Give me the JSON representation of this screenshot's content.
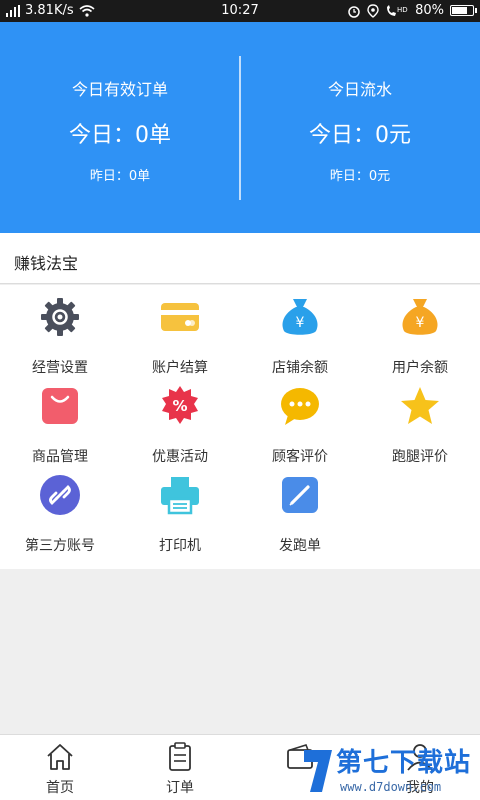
{
  "status_bar": {
    "network": "3.81K/s",
    "time": "10:27",
    "battery": "80%",
    "battery_level": 0.8,
    "hd": "HD"
  },
  "summary": {
    "orders": {
      "title": "今日有效订单",
      "today": "今日：0单",
      "yesterday": "昨日：0单"
    },
    "revenue": {
      "title": "今日流水",
      "today": "今日：0元",
      "yesterday": "昨日：0元"
    }
  },
  "section": {
    "title": "赚钱法宝"
  },
  "tools": [
    {
      "label": "经营设置",
      "icon": "gear-icon",
      "color": "#4a4f5c"
    },
    {
      "label": "账户结算",
      "icon": "card-icon",
      "color": "#f6c23e"
    },
    {
      "label": "店铺余额",
      "icon": "money-bag-icon",
      "color": "#2aa0ea"
    },
    {
      "label": "用户余额",
      "icon": "money-bag-icon",
      "color": "#f5a623"
    },
    {
      "label": "商品管理",
      "icon": "shopping-bag-icon",
      "color": "#f25d6c"
    },
    {
      "label": "优惠活动",
      "icon": "discount-badge-icon",
      "color": "#e8334a"
    },
    {
      "label": "顾客评价",
      "icon": "chat-bubble-icon",
      "color": "#f5b800"
    },
    {
      "label": "跑腿评价",
      "icon": "star-icon",
      "color": "#f7c21a"
    },
    {
      "label": "第三方账号",
      "icon": "link-icon",
      "color": "#5b62d6"
    },
    {
      "label": "打印机",
      "icon": "printer-icon",
      "color": "#3fc4dd"
    },
    {
      "label": "发跑单",
      "icon": "pencil-icon",
      "color": "#4a8ce8"
    }
  ],
  "tabs": [
    {
      "label": "首页",
      "icon": "home-icon"
    },
    {
      "label": "订单",
      "icon": "clipboard-icon"
    },
    {
      "label": "",
      "icon": "wallet-icon"
    },
    {
      "label": "我的",
      "icon": "user-icon"
    }
  ],
  "watermark": {
    "text": "第七下载站",
    "url": "www.d7down.com"
  },
  "colors": {
    "accent": "#2f92f5"
  }
}
